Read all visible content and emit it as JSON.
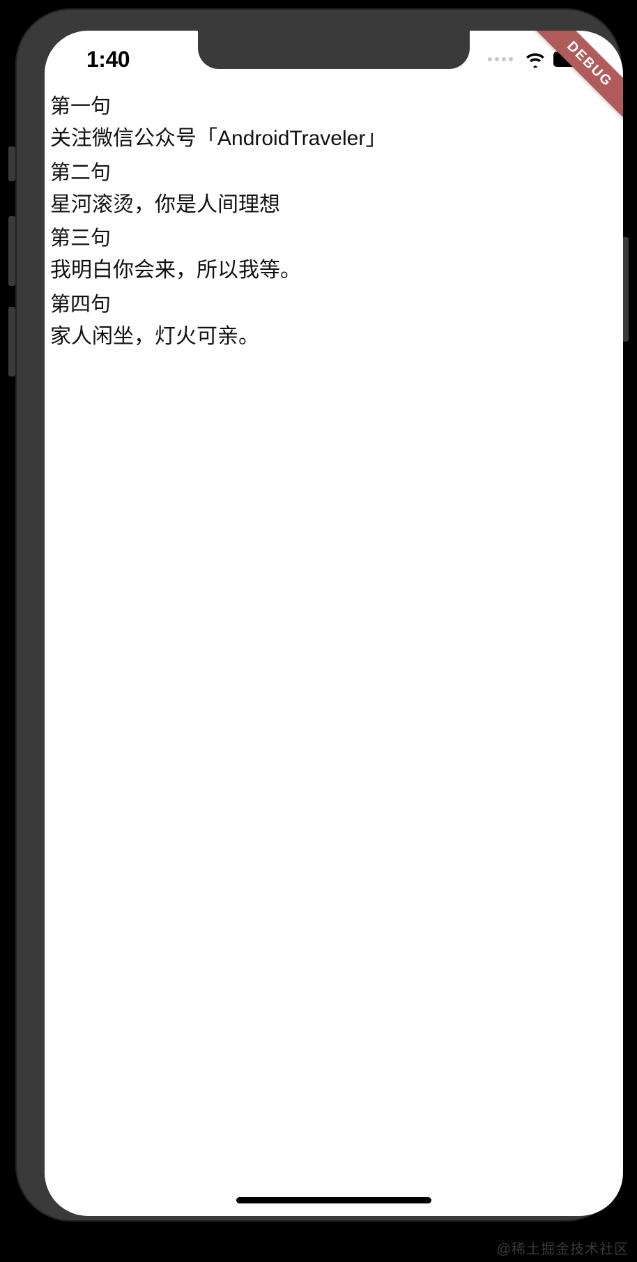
{
  "status": {
    "time": "1:40"
  },
  "debug_label": "DEBUG",
  "items": [
    {
      "header": "第一句",
      "body": "关注微信公众号「AndroidTraveler」"
    },
    {
      "header": "第二句",
      "body": "星河滚烫，你是人间理想"
    },
    {
      "header": "第三句",
      "body": "我明白你会来，所以我等。"
    },
    {
      "header": "第四句",
      "body": "家人闲坐，灯火可亲。"
    }
  ],
  "watermark": "@稀土掘金技术社区"
}
